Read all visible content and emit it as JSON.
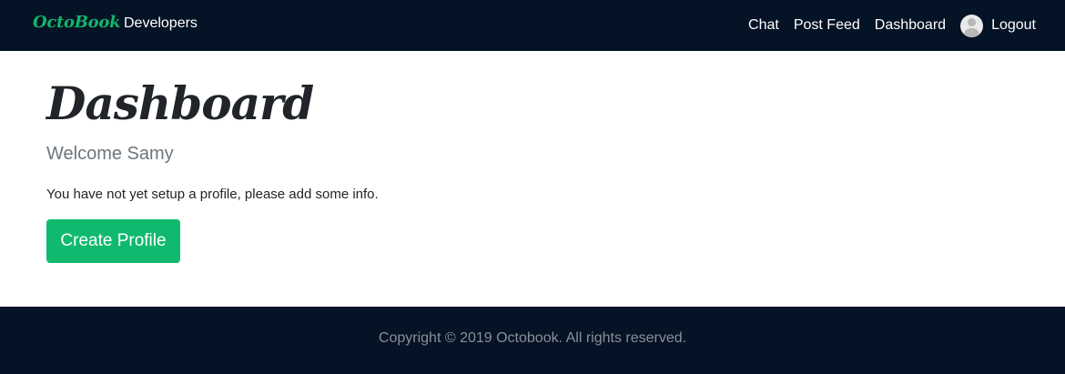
{
  "navbar": {
    "brand": "OctoBook",
    "left_links": [
      "Developers"
    ],
    "right_links": [
      "Chat",
      "Post Feed",
      "Dashboard"
    ],
    "logout_label": "Logout"
  },
  "main": {
    "title": "Dashboard",
    "welcome": "Welcome Samy",
    "info": "You have not yet setup a profile, please add some info.",
    "create_button_label": "Create Profile"
  },
  "footer": {
    "copyright": "Copyright © 2019 Octobook. All rights reserved."
  },
  "colors": {
    "navbar_bg": "#041325",
    "brand": "#12b66b",
    "accent_button": "#0fba6e",
    "muted_text": "#6c757d"
  },
  "icons": {
    "avatar": "user-avatar-icon"
  }
}
